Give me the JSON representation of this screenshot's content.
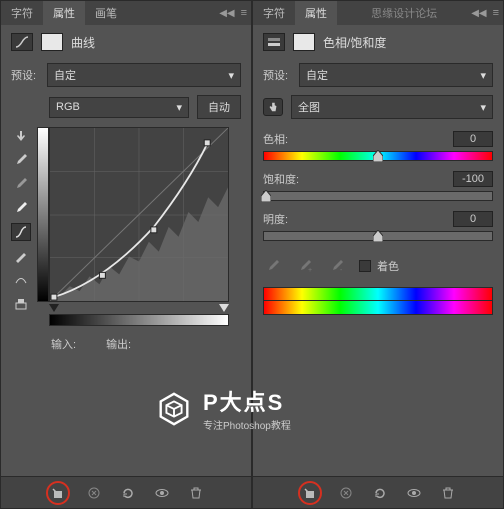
{
  "left": {
    "tabs": [
      "字符",
      "属性",
      "画笔"
    ],
    "active_tab": 1,
    "title": "曲线",
    "preset_label": "预设:",
    "preset_value": "自定",
    "channel_value": "RGB",
    "auto_btn": "自动",
    "input_label": "输入:",
    "output_label": "输出:",
    "curve_points": [
      [
        0,
        0
      ],
      [
        75,
        35
      ],
      [
        150,
        105
      ],
      [
        225,
        255
      ]
    ]
  },
  "right": {
    "tabs": [
      "字符",
      "属性"
    ],
    "active_tab": 1,
    "title": "色相/饱和度",
    "preset_label": "预设:",
    "preset_value": "自定",
    "channel_value": "全图",
    "hue_label": "色相:",
    "hue_value": "0",
    "sat_label": "饱和度:",
    "sat_value": "-100",
    "light_label": "明度:",
    "light_value": "0",
    "colorize_label": "着色"
  },
  "watermark": {
    "title": "P大点S",
    "subtitle": "专注Photoshop教程"
  },
  "topmark": "思缘设计论坛",
  "chart_data": {
    "type": "line",
    "title": "Curves Adjustment",
    "xlabel": "Input",
    "ylabel": "Output",
    "xlim": [
      0,
      255
    ],
    "ylim": [
      0,
      255
    ],
    "series": [
      {
        "name": "RGB",
        "values": [
          [
            0,
            0
          ],
          [
            75,
            35
          ],
          [
            150,
            105
          ],
          [
            225,
            255
          ]
        ]
      }
    ]
  }
}
